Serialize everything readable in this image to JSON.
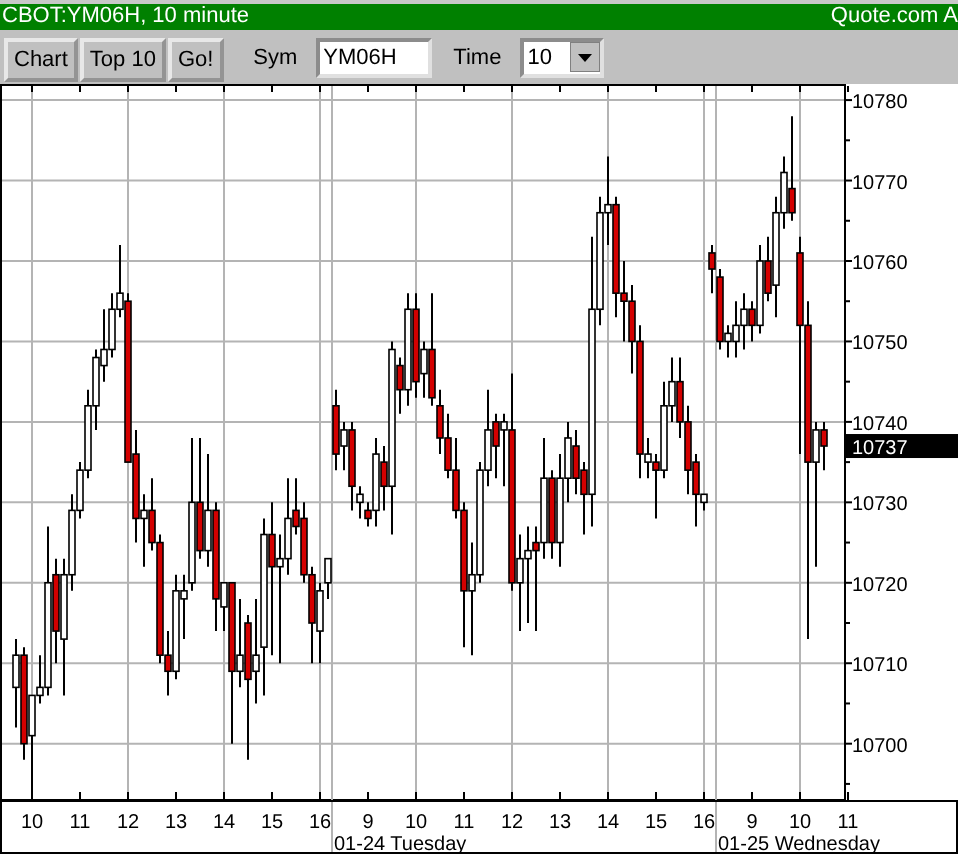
{
  "title_bar": {
    "title": "CBOT:YM06H, 10 minute",
    "brand": "Quote.com A"
  },
  "toolbar": {
    "buttons": [
      "Chart",
      "Top 10",
      "Go!"
    ],
    "symbol": {
      "label": "Sym",
      "value": "YM06H"
    },
    "interval": {
      "label": "Time",
      "value": "10"
    }
  },
  "chart": {
    "chart_data": {
      "type": "candlestick",
      "grid": true,
      "ylim": [
        10693,
        10782
      ],
      "yticks": [
        10700,
        10710,
        10720,
        10730,
        10740,
        10750,
        10760,
        10770,
        10780
      ],
      "categories": [
        null,
        null,
        "10",
        null,
        null,
        null,
        null,
        null,
        "11",
        null,
        null,
        null,
        null,
        null,
        "12",
        null,
        null,
        null,
        null,
        null,
        "13",
        null,
        null,
        null,
        null,
        null,
        "14",
        null,
        null,
        null,
        null,
        null,
        "15",
        null,
        null,
        null,
        null,
        null,
        "16",
        null,
        null,
        null,
        null,
        null,
        "9",
        null,
        null,
        null,
        null,
        null,
        "10",
        null,
        null,
        null,
        null,
        null,
        "11",
        null,
        null,
        null,
        null,
        null,
        "12",
        null,
        null,
        null,
        null,
        null,
        "13",
        null,
        null,
        null,
        null,
        null,
        "14",
        null,
        null,
        null,
        null,
        null,
        "15",
        null,
        null,
        null,
        null,
        null,
        "16",
        null,
        null,
        null,
        null,
        null,
        "9",
        null,
        null,
        null,
        null,
        null,
        "10",
        null,
        null,
        null,
        null,
        null,
        "11"
      ],
      "ohlc": [
        [
          10707,
          10713,
          10702,
          10711
        ],
        [
          10711,
          10712,
          10698,
          10700
        ],
        [
          10701,
          10706,
          10694,
          10706
        ],
        [
          10706,
          10711,
          10705,
          10707
        ],
        [
          10707,
          10727,
          10706,
          10720
        ],
        [
          10721,
          10723,
          10710,
          10714
        ],
        [
          10713,
          10723,
          10706,
          10721
        ],
        [
          10721,
          10731,
          10719,
          10729
        ],
        [
          10729,
          10735,
          10728,
          10734
        ],
        [
          10734,
          10744,
          10733,
          10742
        ],
        [
          10742,
          10749,
          10739,
          10748
        ],
        [
          10747,
          10754,
          10745,
          10749
        ],
        [
          10749,
          10756,
          10748,
          10754
        ],
        [
          10754,
          10762,
          10753,
          10756
        ],
        [
          10755,
          10756,
          10735,
          10735
        ],
        [
          10736,
          10739,
          10725,
          10728
        ],
        [
          10728,
          10731,
          10722,
          10729
        ],
        [
          10729,
          10733,
          10724,
          10725
        ],
        [
          10725,
          10726,
          10710,
          10711
        ],
        [
          10711,
          10714,
          10706,
          10709
        ],
        [
          10709,
          10721,
          10708,
          10719
        ],
        [
          10718,
          10721,
          10713,
          10719
        ],
        [
          10720,
          10738,
          10719,
          10730
        ],
        [
          10730,
          10738,
          10723,
          10724
        ],
        [
          10724,
          10736,
          10722,
          10729
        ],
        [
          10729,
          10730,
          10714,
          10718
        ],
        [
          10717,
          10720,
          10714,
          10720
        ],
        [
          10720,
          10720,
          10700,
          10709
        ],
        [
          10709,
          10718,
          10707,
          10711
        ],
        [
          10715,
          10716,
          10698,
          10708
        ],
        [
          10709,
          10718,
          10705,
          10711
        ],
        [
          10712,
          10728,
          10706,
          10726
        ],
        [
          10726,
          10730,
          10711,
          10722
        ],
        [
          10722,
          10726,
          10710,
          10723
        ],
        [
          10723,
          10733,
          10721,
          10728
        ],
        [
          10729,
          10733,
          10726,
          10727
        ],
        [
          10728,
          10730,
          10720,
          10721
        ],
        [
          10721,
          10722,
          10710,
          10715
        ],
        [
          10714,
          10720,
          10710,
          10719
        ],
        [
          10720,
          10723,
          10718,
          10723
        ],
        [
          10742,
          10744,
          10734,
          10736
        ],
        [
          10737,
          10740,
          10734,
          10739
        ],
        [
          10739,
          10740,
          10729,
          10732
        ],
        [
          10730,
          10732,
          10728,
          10731
        ],
        [
          10729,
          10730,
          10727,
          10728
        ],
        [
          10729,
          10738,
          10727,
          10736
        ],
        [
          10735,
          10737,
          10729,
          10732
        ],
        [
          10732,
          10750,
          10726,
          10749
        ],
        [
          10747,
          10748,
          10741,
          10744
        ],
        [
          10744,
          10756,
          10742,
          10754
        ],
        [
          10754,
          10756,
          10743,
          10745
        ],
        [
          10746,
          10750,
          10743,
          10749
        ],
        [
          10749,
          10756,
          10742,
          10743
        ],
        [
          10742,
          10744,
          10736,
          10738
        ],
        [
          10738,
          10741,
          10733,
          10734
        ],
        [
          10734,
          10738,
          10728,
          10729
        ],
        [
          10729,
          10730,
          10712,
          10719
        ],
        [
          10719,
          10725,
          10711,
          10721
        ],
        [
          10721,
          10735,
          10720,
          10734
        ],
        [
          10734,
          10744,
          10732,
          10739
        ],
        [
          10740,
          10741,
          10733,
          10737
        ],
        [
          10739,
          10741,
          10732,
          10740
        ],
        [
          10739,
          10746,
          10719,
          10720
        ],
        [
          10720,
          10726,
          10714,
          10723
        ],
        [
          10723,
          10727,
          10715,
          10724
        ],
        [
          10725,
          10727,
          10714,
          10724
        ],
        [
          10725,
          10738,
          10723,
          10733
        ],
        [
          10733,
          10734,
          10723,
          10725
        ],
        [
          10725,
          10736,
          10722,
          10733
        ],
        [
          10733,
          10740,
          10730,
          10738
        ],
        [
          10737,
          10739,
          10731,
          10733
        ],
        [
          10734,
          10735,
          10726,
          10731
        ],
        [
          10731,
          10763,
          10727,
          10754
        ],
        [
          10754,
          10768,
          10752,
          10766
        ],
        [
          10766,
          10773,
          10762,
          10767
        ],
        [
          10767,
          10768,
          10753,
          10756
        ],
        [
          10756,
          10760,
          10750,
          10755
        ],
        [
          10755,
          10757,
          10746,
          10750
        ],
        [
          10750,
          10752,
          10733,
          10736
        ],
        [
          10735,
          10738,
          10733,
          10736
        ],
        [
          10735,
          10736,
          10728,
          10734
        ],
        [
          10734,
          10745,
          10733,
          10742
        ],
        [
          10742,
          10748,
          10740,
          10745
        ],
        [
          10745,
          10748,
          10738,
          10740
        ],
        [
          10740,
          10742,
          10731,
          10734
        ],
        [
          10735,
          10736,
          10727,
          10731
        ],
        [
          10730,
          10731,
          10729,
          10731
        ],
        [
          10761,
          10762,
          10756,
          10759
        ],
        [
          10758,
          10759,
          10749,
          10750
        ],
        [
          10750,
          10752,
          10748,
          10751
        ],
        [
          10750,
          10755,
          10748,
          10752
        ],
        [
          10752,
          10756,
          10749,
          10754
        ],
        [
          10754,
          10755,
          10750,
          10752
        ],
        [
          10752,
          10762,
          10751,
          10760
        ],
        [
          10760,
          10763,
          10755,
          10756
        ],
        [
          10757,
          10768,
          10753,
          10766
        ],
        [
          10766,
          10773,
          10764,
          10771
        ],
        [
          10769,
          10778,
          10765,
          10766
        ],
        [
          10761,
          10763,
          10736,
          10752
        ],
        [
          10752,
          10755,
          10713,
          10735
        ],
        [
          10735,
          10740,
          10722,
          10739
        ],
        [
          10739,
          10740,
          10734,
          10737
        ],
        null,
        null,
        null
      ],
      "annotations": [
        "01-24 Tuesday",
        "01-25 Wednesday"
      ]
    },
    "last_price": "10737"
  }
}
